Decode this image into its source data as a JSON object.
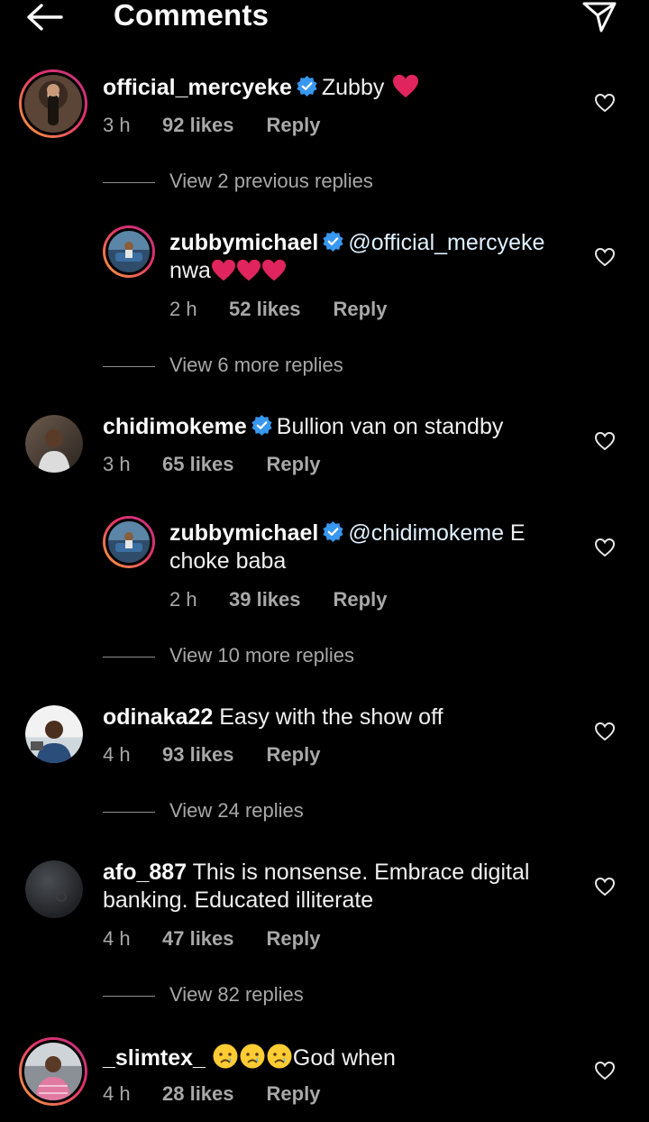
{
  "header": {
    "title": "Comments",
    "back_icon": "arrow-left-icon",
    "share_icon": "paper-plane-icon"
  },
  "colors": {
    "background": "#000000",
    "text": "#f5f5f5",
    "meta": "#a8a8a8",
    "verified": "#3897f0",
    "heart": "#e0245e"
  },
  "comments": [
    {
      "username": "official_mercyeke",
      "verified": true,
      "text": "Zubby",
      "emoji": "red-heart",
      "time": "3 h",
      "likes": "92 likes",
      "reply": "Reply",
      "view_replies": "View 2 previous replies"
    },
    {
      "username": "zubbymichael",
      "verified": true,
      "mention": "@official_mercyeke",
      "text_line2": "nwa",
      "emoji": "red-heart x3",
      "time": "2 h",
      "likes": "52 likes",
      "reply": "Reply",
      "view_replies": "View 6 more replies"
    },
    {
      "username": "chidimokeme",
      "verified": true,
      "text": "Bullion van on standby",
      "time": "3 h",
      "likes": "65 likes",
      "reply": "Reply"
    },
    {
      "username": "zubbymichael",
      "verified": true,
      "mention": "@chidimokeme",
      "text_tail": " E",
      "text_line2": "choke baba",
      "time": "2 h",
      "likes": "39 likes",
      "reply": "Reply",
      "view_replies": "View 10 more replies"
    },
    {
      "username": "odinaka22",
      "text": "Easy with the show off",
      "time": "4 h",
      "likes": "93 likes",
      "reply": "Reply",
      "view_replies": "View 24 replies"
    },
    {
      "username": "afo_887",
      "text": "This is nonsense. Embrace digital",
      "text_line2": "banking. Educated illiterate",
      "time": "4 h",
      "likes": "47 likes",
      "reply": "Reply",
      "view_replies": "View 82 replies"
    },
    {
      "username": "_slimtex_",
      "emoji": "crying-face x3",
      "text": "God when",
      "time": "4 h",
      "likes": "28 likes",
      "reply": "Reply"
    }
  ]
}
